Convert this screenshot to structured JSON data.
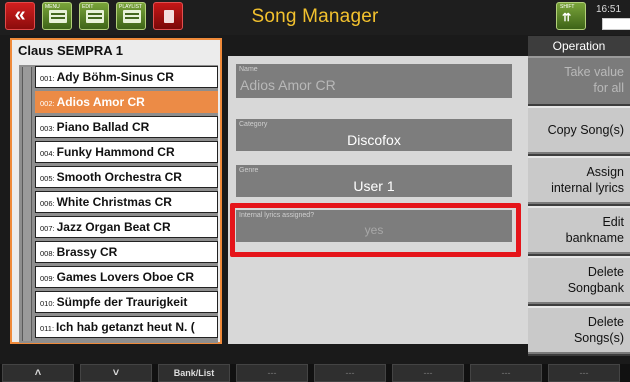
{
  "topbar": {
    "back_icon": "double-chevron-left-icon",
    "btn2_caption": "MENU",
    "btn3_caption": "EDIT",
    "btn4_caption": "PLAYLIST",
    "title": "Song Manager",
    "right_caption": "SHIFT",
    "clock": "16:51"
  },
  "bank": {
    "title": "Claus SEMPRA 1",
    "items": [
      {
        "num": "001:",
        "label": "Ady Böhm-Sinus CR"
      },
      {
        "num": "002:",
        "label": "Adios Amor CR"
      },
      {
        "num": "003:",
        "label": "Piano Ballad CR"
      },
      {
        "num": "004:",
        "label": "Funky Hammond CR"
      },
      {
        "num": "005:",
        "label": "Smooth Orchestra CR"
      },
      {
        "num": "006:",
        "label": "White Christmas CR"
      },
      {
        "num": "007:",
        "label": "Jazz Organ Beat CR"
      },
      {
        "num": "008:",
        "label": "Brassy CR"
      },
      {
        "num": "009:",
        "label": "Games Lovers Oboe CR"
      },
      {
        "num": "010:",
        "label": "Sümpfe der Traurigkeit"
      },
      {
        "num": "011:",
        "label": "Ich hab getanzt heut N. ("
      }
    ],
    "selected_index": 1
  },
  "details": {
    "name_label": "Name",
    "name_value": "Adios Amor CR",
    "category_label": "Category",
    "category_value": "Discofox",
    "genre_label": "Genre",
    "genre_value": "User 1",
    "lyrics_label": "Internal lyrics assigned?",
    "lyrics_value": "yes"
  },
  "operation": {
    "title": "Operation",
    "buttons": [
      {
        "line1": "Take value",
        "line2": "for all"
      },
      {
        "line1": "Copy Song(s)",
        "line2": ""
      },
      {
        "line1": "Assign",
        "line2": "internal lyrics"
      },
      {
        "line1": "Edit",
        "line2": "bankname"
      },
      {
        "line1": "Delete",
        "line2": "Songbank"
      },
      {
        "line1": "Delete",
        "line2": "Songs(s)"
      }
    ]
  },
  "bottom": {
    "keys": [
      "^",
      "v",
      "Bank/List",
      "---",
      "---",
      "---",
      "---",
      "---"
    ]
  },
  "colors": {
    "title": "#f2c12e",
    "selected_item": "#ec8b46",
    "panel_border": "#ef8a3a",
    "highlight": "#e5141a"
  }
}
